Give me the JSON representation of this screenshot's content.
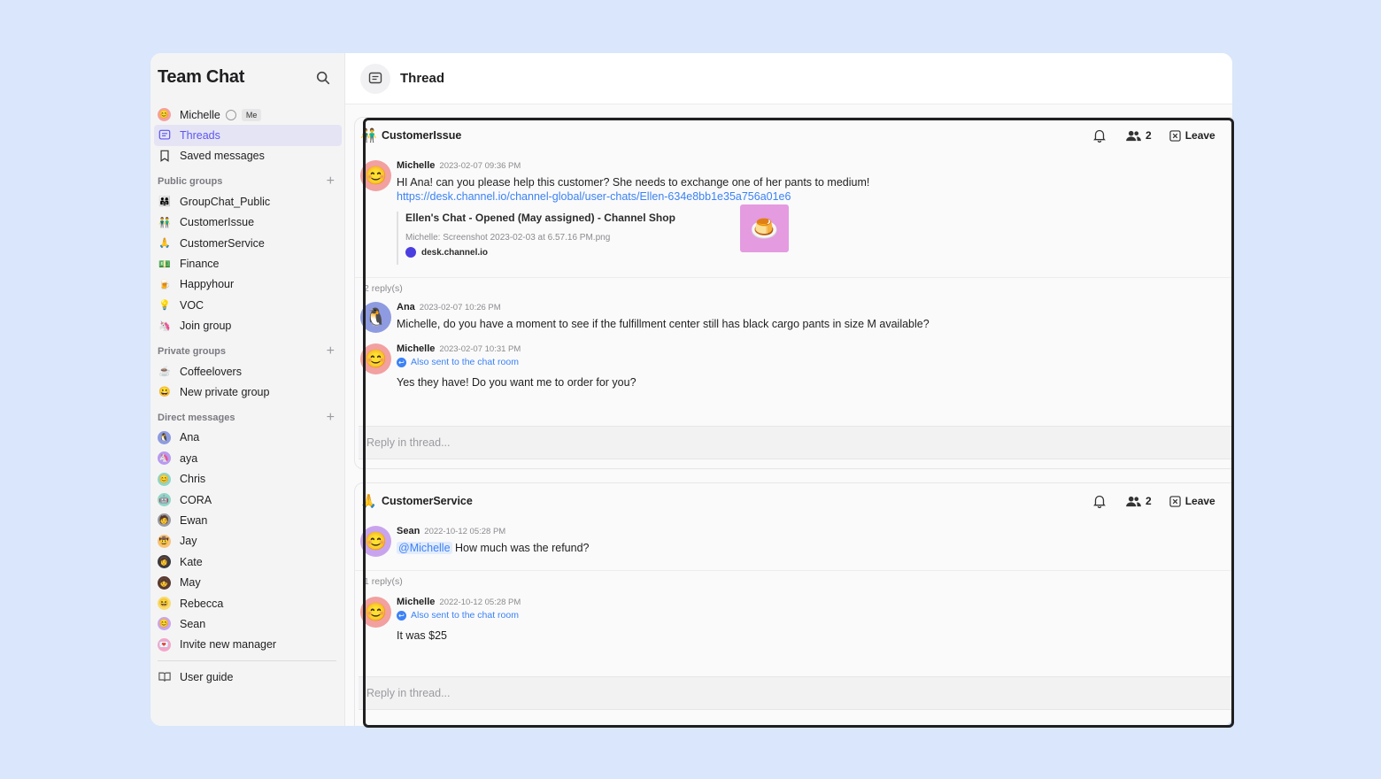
{
  "app": {
    "title": "Team Chat"
  },
  "sidebar": {
    "me": {
      "name": "Michelle",
      "badge": "Me"
    },
    "nav": [
      {
        "label": "Threads",
        "icon": "thread-icon",
        "active": true
      },
      {
        "label": "Saved messages",
        "icon": "bookmark-icon",
        "active": false
      }
    ],
    "public_groups": {
      "title": "Public groups",
      "items": [
        {
          "label": "GroupChat_Public",
          "emoji": "👨‍👩‍👧"
        },
        {
          "label": "CustomerIssue",
          "emoji": "👬"
        },
        {
          "label": "CustomerService",
          "emoji": "🙏"
        },
        {
          "label": "Finance",
          "emoji": "💵"
        },
        {
          "label": "Happyhour",
          "emoji": "🍺"
        },
        {
          "label": "VOC",
          "emoji": "💡"
        },
        {
          "label": "Join group",
          "emoji": "🦄"
        }
      ]
    },
    "private_groups": {
      "title": "Private groups",
      "items": [
        {
          "label": "Coffeelovers",
          "emoji": "☕"
        },
        {
          "label": "New private group",
          "emoji": "😀"
        }
      ]
    },
    "direct_messages": {
      "title": "Direct messages",
      "items": [
        {
          "label": "Ana",
          "emoji": "🐧",
          "color": "#8e9be0"
        },
        {
          "label": "aya",
          "emoji": "🦄",
          "color": "#b89af0"
        },
        {
          "label": "Chris",
          "emoji": "😊",
          "color": "#8fd6c8"
        },
        {
          "label": "CORA",
          "emoji": "🤖",
          "color": "#8fd6c8"
        },
        {
          "label": "Ewan",
          "emoji": "🧑",
          "color": "#9a9aa0"
        },
        {
          "label": "Jay",
          "emoji": "🤠",
          "color": "#f5c27a"
        },
        {
          "label": "Kate",
          "emoji": "👩",
          "color": "#3a3a40"
        },
        {
          "label": "May",
          "emoji": "👧",
          "color": "#5a3a30"
        },
        {
          "label": "Rebecca",
          "emoji": "😆",
          "color": "#f7dc6f"
        },
        {
          "label": "Sean",
          "emoji": "😊",
          "color": "#c9a4ee"
        },
        {
          "label": "Invite new manager",
          "emoji": "💌",
          "color": "#f4a6c8"
        }
      ]
    },
    "footer": {
      "label": "User guide"
    }
  },
  "main": {
    "title": "Thread",
    "reply_placeholder": "Reply in thread...",
    "threads": [
      {
        "group": "CustomerIssue",
        "group_emoji": "👬",
        "members": "2",
        "leave_label": "Leave",
        "root": {
          "author": "Michelle",
          "time": "2023-02-07 09:36 PM",
          "text": "HI Ana! can you please help this customer? She needs to exchange one of her pants to medium!",
          "link": "https://desk.channel.io/channel-global/user-chats/Ellen-634e8bb1e35a756a01e6",
          "preview": {
            "title": "Ellen's Chat - Opened (May assigned) - Channel Shop",
            "desc": "Michelle: Screenshot 2023-02-03 at 6.57.16 PM.png",
            "site": "desk.channel.io"
          }
        },
        "reply_count": "2 reply(s)",
        "replies": [
          {
            "author": "Ana",
            "time": "2023-02-07 10:26 PM",
            "text": "Michelle, do you have a moment to see if the fulfillment center still has black cargo pants in size M available?"
          },
          {
            "author": "Michelle",
            "time": "2023-02-07 10:31 PM",
            "also_sent": "Also sent to the chat room",
            "text": "Yes they have! Do you want me to order for you?"
          }
        ]
      },
      {
        "group": "CustomerService",
        "group_emoji": "🙏",
        "members": "2",
        "leave_label": "Leave",
        "root": {
          "author": "Sean",
          "time": "2022-10-12 05:28 PM",
          "mention": "@Michelle",
          "text": " How much was the refund?"
        },
        "reply_count": "1 reply(s)",
        "replies": [
          {
            "author": "Michelle",
            "time": "2022-10-12 05:28 PM",
            "also_sent": "Also sent to the chat room",
            "text": "It was $25"
          }
        ]
      }
    ]
  }
}
